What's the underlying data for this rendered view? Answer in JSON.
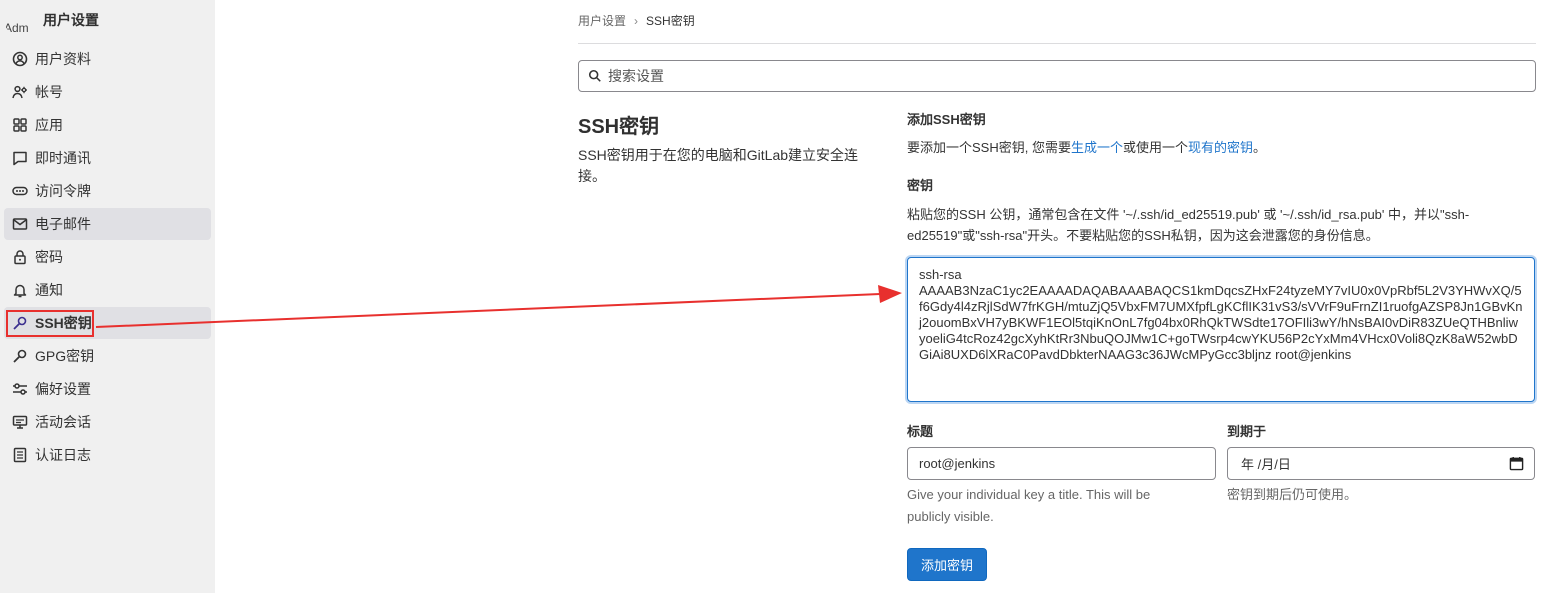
{
  "sidebar": {
    "avatar_text": "Adm",
    "title": "用户设置",
    "items": [
      {
        "label": "用户资料",
        "icon": "user-circle-icon"
      },
      {
        "label": "帐号",
        "icon": "account-settings-icon"
      },
      {
        "label": "应用",
        "icon": "applications-grid-icon"
      },
      {
        "label": "即时通讯",
        "icon": "chat-icon"
      },
      {
        "label": "访问令牌",
        "icon": "token-icon"
      },
      {
        "label": "电子邮件",
        "icon": "mail-icon"
      },
      {
        "label": "密码",
        "icon": "lock-icon"
      },
      {
        "label": "通知",
        "icon": "bell-icon"
      },
      {
        "label": "SSH密钥",
        "icon": "key-icon"
      },
      {
        "label": "GPG密钥",
        "icon": "key-icon"
      },
      {
        "label": "偏好设置",
        "icon": "preferences-icon"
      },
      {
        "label": "活动会话",
        "icon": "monitor-icon"
      },
      {
        "label": "认证日志",
        "icon": "log-icon"
      }
    ]
  },
  "breadcrumb": {
    "parent": "用户设置",
    "separator": "›",
    "current": "SSH密钥"
  },
  "search": {
    "placeholder": "搜索设置"
  },
  "left_section": {
    "title": "SSH密钥",
    "description": "SSH密钥用于在您的电脑和GitLab建立安全连接。"
  },
  "add_key": {
    "heading": "添加SSH密钥",
    "intro_prefix": "要添加一个SSH密钥, 您需要",
    "link_generate": "生成一个",
    "intro_middle": "或使用一个",
    "link_existing": "现有的密钥",
    "intro_suffix": "。",
    "key_label": "密钥",
    "key_help_line1": "粘贴您的SSH 公钥，通常包含在文件 '~/.ssh/id_ed25519.pub' 或 '~/.ssh/id_rsa.pub' 中，并以\"ssh-",
    "key_help_line2": "ed25519\"或\"ssh-rsa\"开头。不要粘贴您的SSH私钥，因为这会泄露您的身份信息。",
    "key_value": "ssh-rsa\nAAAAB3NzaC1yc2EAAAADAQABAAABAQCS1kmDqcsZHxF24tyzeMY7vIU0x0VpRbf5L2V3YHWvXQ/5f6Gdy4l4zRjlSdW7frKGH/mtuZjQ5VbxFM7UMXfpfLgKCflIK31vS3/sVVrF9uFrnZI1ruofgAZSP8Jn1GBvKnj2ouomBxVH7yBKWF1EOl5tqiKnOnL7fg04bx0RhQkTWSdte17OFIli3wY/hNsBAI0vDiR83ZUeQTHBnliwyoeliG4tcRoz42gcXyhKtRr3NbuQOJMw1C+goTWsrp4cwYKU56P2cYxMm4VHcx0Voli8QzK8aW52wbDGiAi8UXD6lXRaC0PavdDbkterNAAG3c36JWcMPyGcc3bljnz root@jenkins",
    "title_label": "标题",
    "title_value": "root@jenkins",
    "title_help": "Give your individual key a title. This will be publicly visible.",
    "expires_label": "到期于",
    "expires_value": "年 /月/日",
    "expires_help": "密钥到期后仍可使用。",
    "submit_label": "添加密钥"
  },
  "colors": {
    "accent": "#1f75cb",
    "annotation": "#e8302e"
  }
}
